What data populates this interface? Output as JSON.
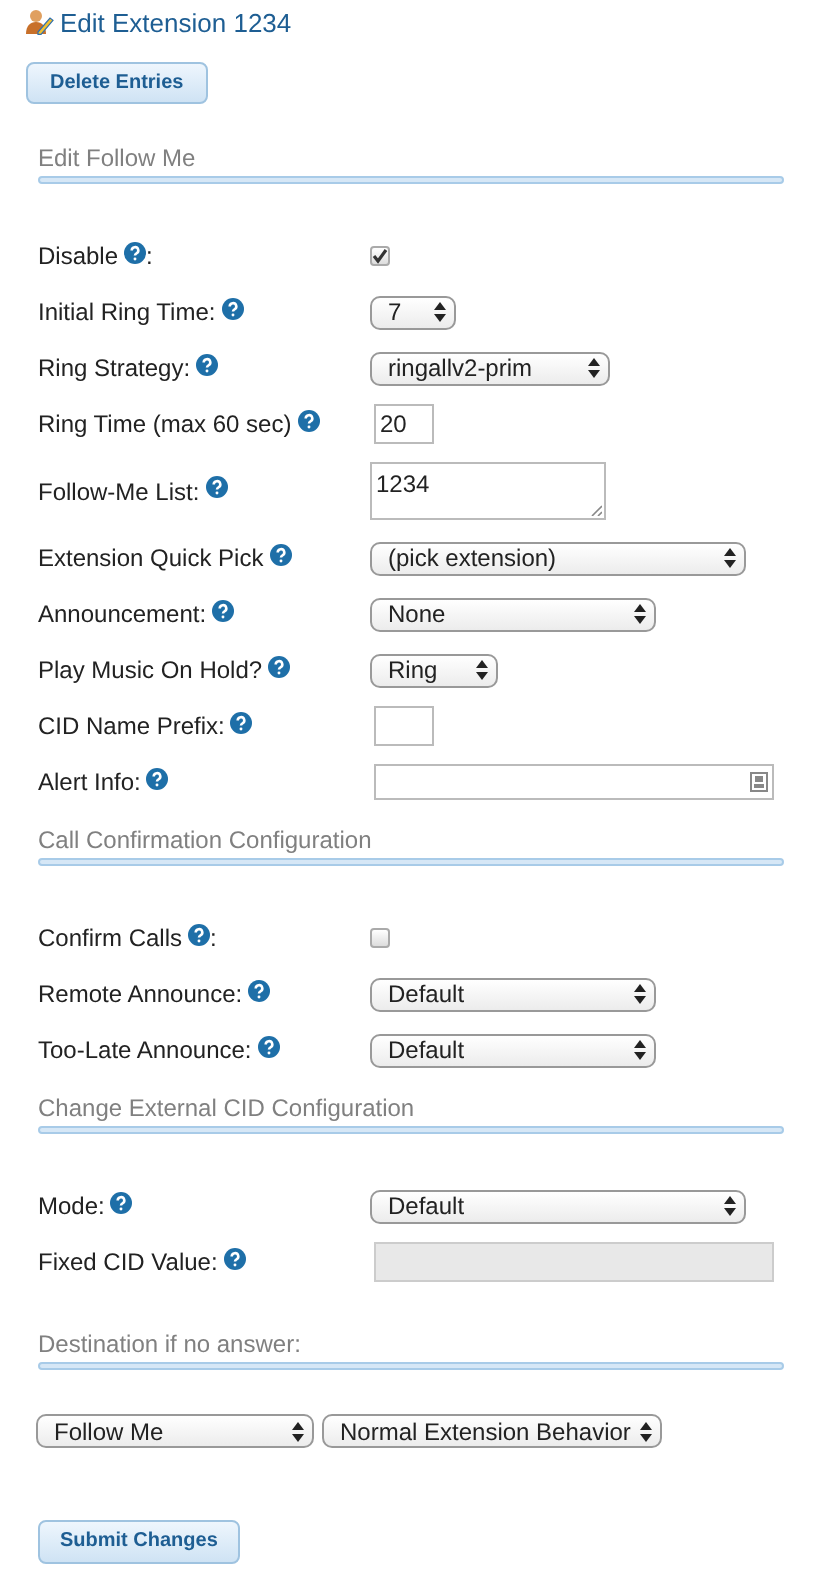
{
  "title": "Edit Extension 1234",
  "delete_button": "Delete Entries",
  "sections": [
    {
      "title": "Edit Follow Me",
      "rows": [
        {
          "label": "Disable",
          "suffix": ":",
          "kind": "checkbox",
          "checked": true
        },
        {
          "label": "Initial Ring Time:",
          "kind": "select",
          "value": "7"
        },
        {
          "label": "Ring Strategy:",
          "kind": "select",
          "value": "ringallv2-prim"
        },
        {
          "label": "Ring Time (max 60 sec)",
          "kind": "text",
          "value": "20"
        },
        {
          "label": "Follow-Me List:",
          "kind": "textarea",
          "value": "1234"
        },
        {
          "label": "Extension Quick Pick",
          "kind": "select",
          "value": "(pick extension)"
        },
        {
          "label": "Announcement:",
          "kind": "select",
          "value": "None"
        },
        {
          "label": "Play Music On Hold?",
          "kind": "select",
          "value": "Ring"
        },
        {
          "label": "CID Name Prefix:",
          "kind": "text",
          "value": ""
        },
        {
          "label": "Alert Info:",
          "kind": "alert",
          "value": ""
        }
      ]
    },
    {
      "title": "Call Confirmation Configuration",
      "rows": [
        {
          "label": "Confirm Calls",
          "suffix": ":",
          "kind": "checkbox",
          "checked": false
        },
        {
          "label": "Remote Announce:",
          "kind": "select",
          "value": "Default"
        },
        {
          "label": "Too-Late Announce:",
          "kind": "select",
          "value": "Default"
        }
      ]
    },
    {
      "title": "Change External CID Configuration",
      "rows": [
        {
          "label": "Mode:",
          "kind": "select",
          "value": "Default"
        },
        {
          "label": "Fixed CID Value:",
          "kind": "disabled",
          "value": ""
        }
      ]
    }
  ],
  "destination": {
    "title": "Destination if no answer:",
    "selects": [
      "Follow Me",
      "Normal Extension Behavior"
    ]
  },
  "submit_button": "Submit Changes"
}
